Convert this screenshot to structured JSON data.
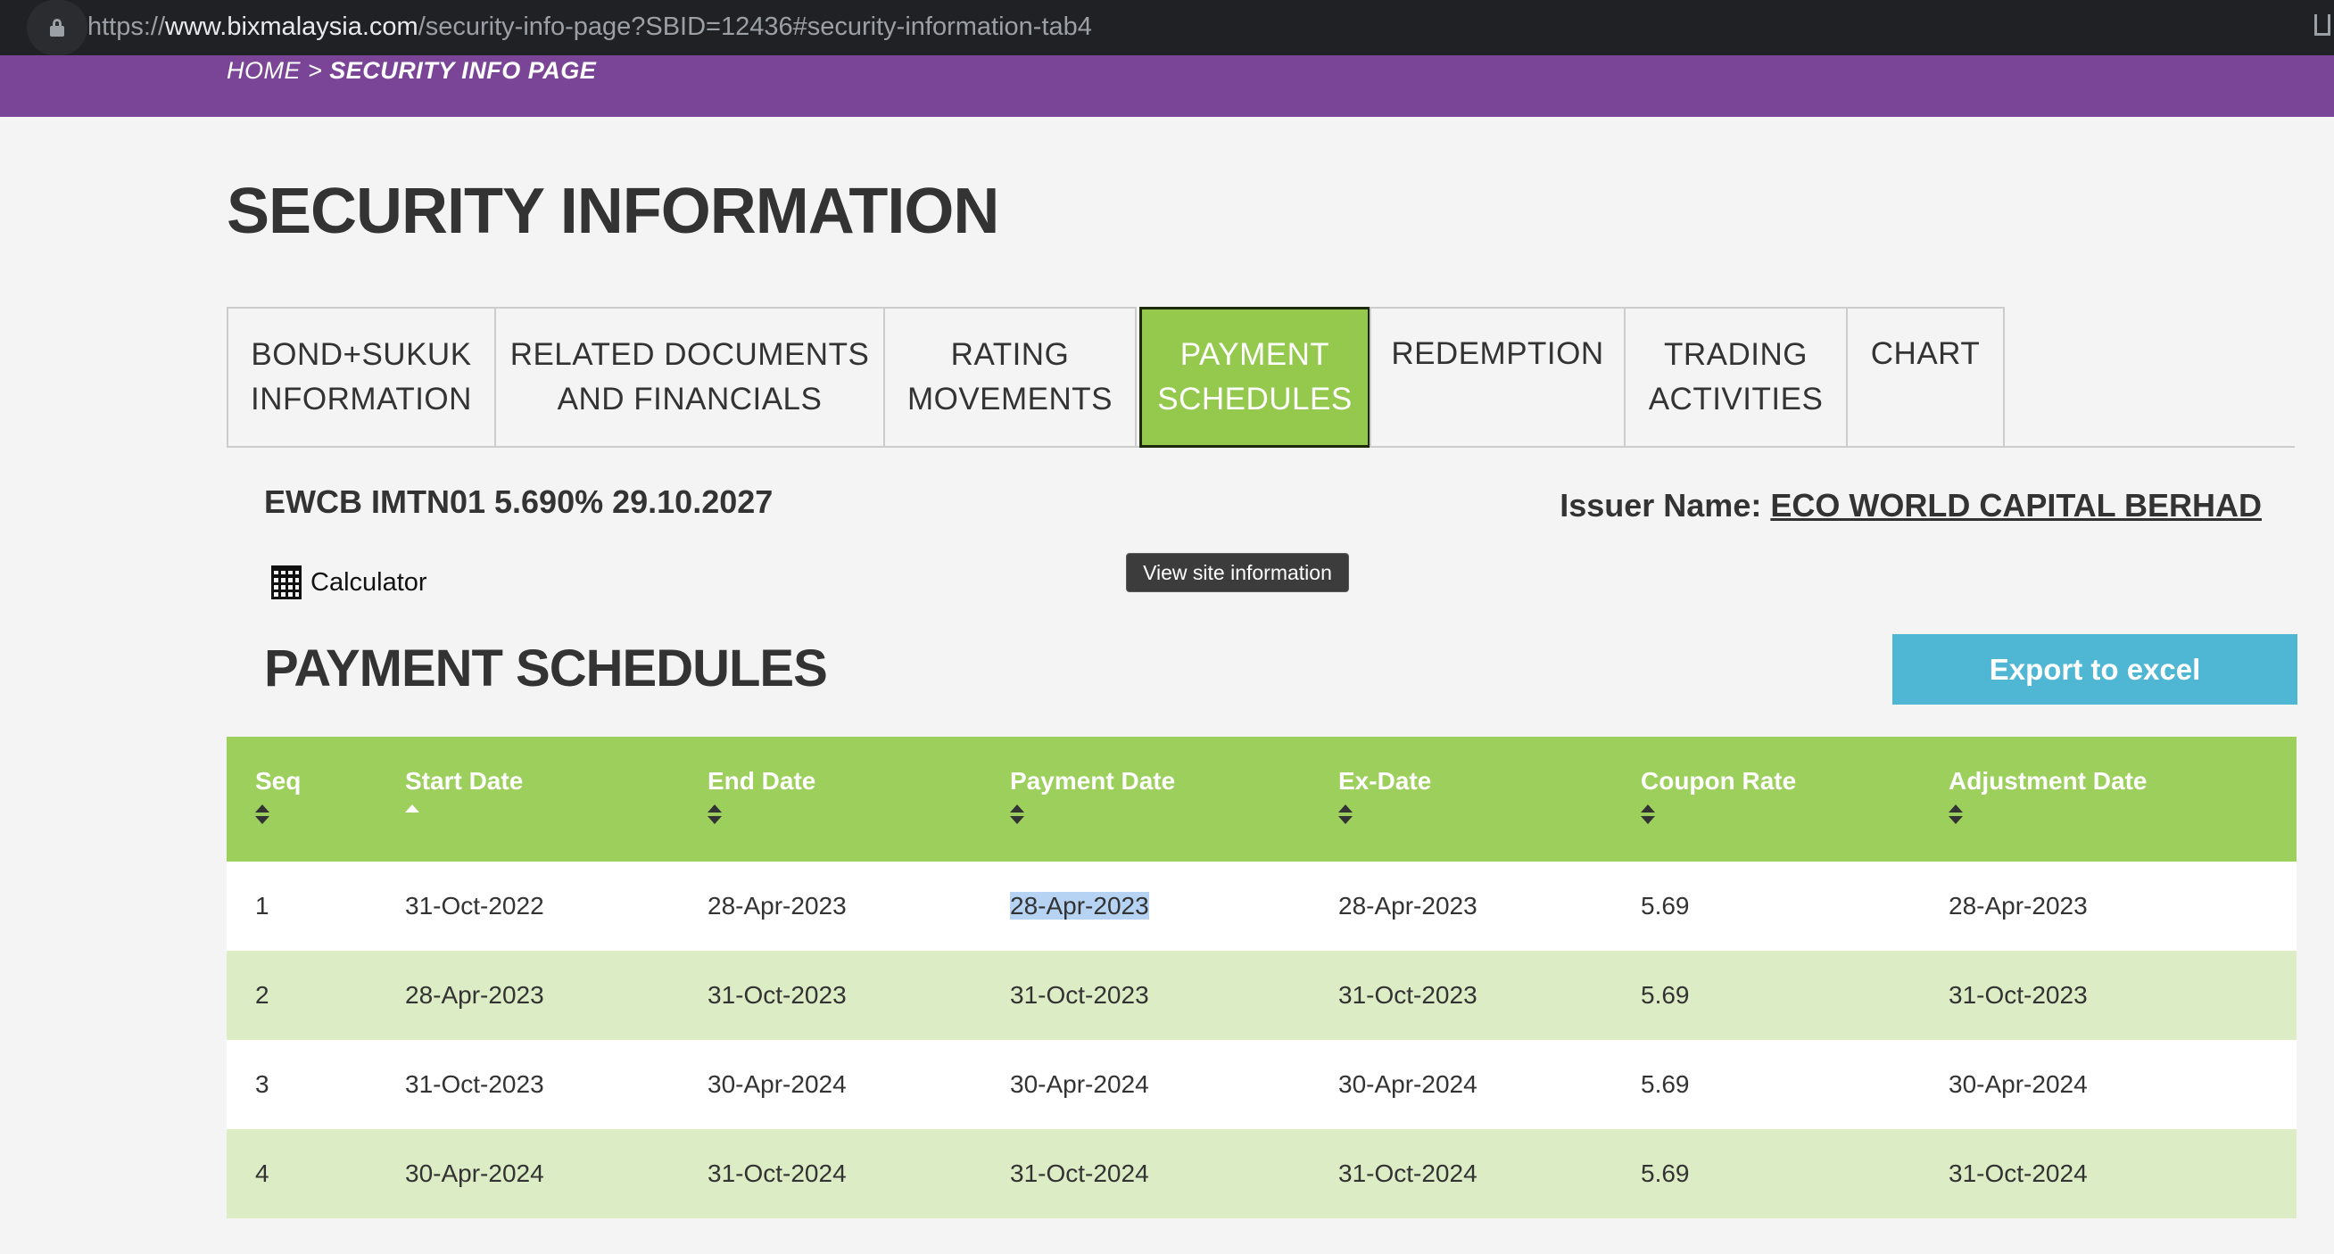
{
  "browser": {
    "url_prefix": "https://",
    "url_host": "www.bixmalaysia.com",
    "url_path": "/security-info-page?SBID=12436#security-information-tab4"
  },
  "breadcrumb": {
    "home": "HOME",
    "separator": " > ",
    "current": "SECURITY INFO PAGE"
  },
  "page_title": "SECURITY INFORMATION",
  "tabs": [
    {
      "label": "BOND+SUKUK\nINFORMATION"
    },
    {
      "label": "RELATED DOCUMENTS\nAND FINANCIALS"
    },
    {
      "label": "RATING\nMOVEMENTS"
    },
    {
      "label": "PAYMENT\nSCHEDULES"
    },
    {
      "label": "REDEMPTION"
    },
    {
      "label": "TRADING\nACTIVITIES"
    },
    {
      "label": "CHART"
    }
  ],
  "active_tab": "PAYMENT SCHEDULES",
  "security_name": "EWCB IMTN01 5.690% 29.10.2027",
  "issuer": {
    "label": "Issuer Name:",
    "name": "ECO WORLD CAPITAL BERHAD"
  },
  "calculator_label": "Calculator",
  "tooltip": "View site information",
  "section_title": "PAYMENT SCHEDULES",
  "export_label": "Export to excel",
  "table": {
    "columns": [
      "Seq",
      "Start Date",
      "End Date",
      "Payment Date",
      "Ex-Date",
      "Coupon Rate",
      "Adjustment Date"
    ],
    "sorted_column": "Start Date",
    "rows": [
      [
        "1",
        "31-Oct-2022",
        "28-Apr-2023",
        "28-Apr-2023",
        "28-Apr-2023",
        "5.69",
        "28-Apr-2023"
      ],
      [
        "2",
        "28-Apr-2023",
        "31-Oct-2023",
        "31-Oct-2023",
        "31-Oct-2023",
        "5.69",
        "31-Oct-2023"
      ],
      [
        "3",
        "31-Oct-2023",
        "30-Apr-2024",
        "30-Apr-2024",
        "30-Apr-2024",
        "5.69",
        "30-Apr-2024"
      ],
      [
        "4",
        "30-Apr-2024",
        "31-Oct-2024",
        "31-Oct-2024",
        "31-Oct-2024",
        "5.69",
        "31-Oct-2024"
      ]
    ]
  },
  "colors": {
    "purple_bar": "#7b4597",
    "green_header": "#9ccf5c",
    "active_tab": "#94c94e",
    "row_alt": "#dcedc6",
    "export_button": "#4fb7d4"
  }
}
